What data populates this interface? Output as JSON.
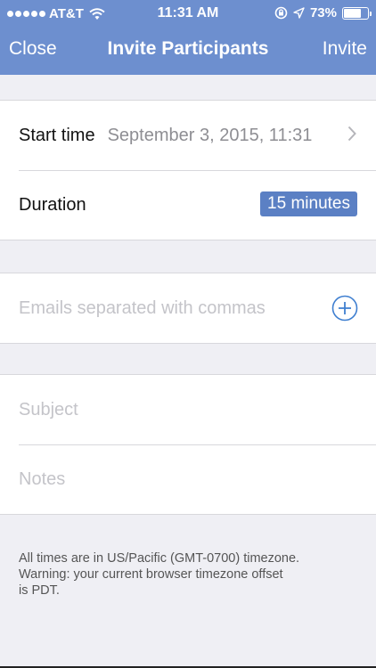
{
  "status_bar": {
    "carrier": "AT&T",
    "time": "11:31 AM",
    "battery": "73%",
    "battery_level": 0.73
  },
  "nav": {
    "left_label": "Close",
    "title": "Invite Participants",
    "right_label": "Invite"
  },
  "schedule": {
    "start_label": "Start time",
    "start_value": "September 3, 2015, 11:31",
    "duration_label": "Duration",
    "duration_value": "15 minutes"
  },
  "emails": {
    "placeholder": "Emails separated with commas"
  },
  "message": {
    "subject_placeholder": "Subject",
    "notes_placeholder": "Notes"
  },
  "footer": {
    "line1": "All times are in US/Pacific (GMT-0700) timezone.",
    "line2": "Warning: your current browser timezone offset",
    "line3": "is PDT."
  },
  "colors": {
    "header": "#6d8fcf",
    "accent": "#3f7fd0",
    "pill": "#5b80c4"
  }
}
